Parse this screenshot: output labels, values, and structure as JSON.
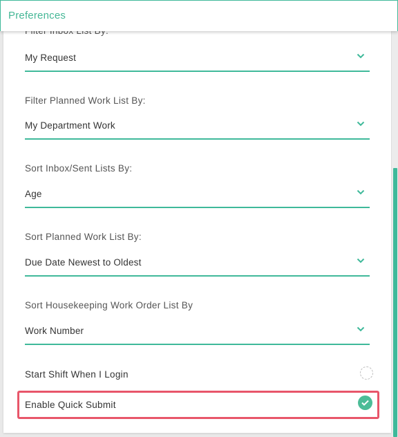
{
  "header": {
    "title": "Preferences"
  },
  "preferences": {
    "filter_inbox": {
      "label": "Filter Inbox List By:",
      "value": "My Request"
    },
    "filter_planned": {
      "label": "Filter Planned Work List By:",
      "value": "My Department Work"
    },
    "sort_inbox_sent": {
      "label": "Sort Inbox/Sent Lists By:",
      "value": "Age"
    },
    "sort_planned": {
      "label": "Sort Planned Work List By:",
      "value": "Due Date Newest to Oldest"
    },
    "sort_housekeeping": {
      "label": "Sort Housekeeping Work Order List By",
      "value": "Work Number"
    },
    "start_shift": {
      "label": "Start Shift When I Login",
      "checked": false
    },
    "quick_submit": {
      "label": "Enable Quick Submit",
      "checked": true
    }
  },
  "colors": {
    "accent": "#3fb99a",
    "highlight": "#e8566a",
    "check": "#4cbc97"
  },
  "icons": {
    "dropdown": "chevron-down-icon",
    "checked": "check-icon"
  }
}
